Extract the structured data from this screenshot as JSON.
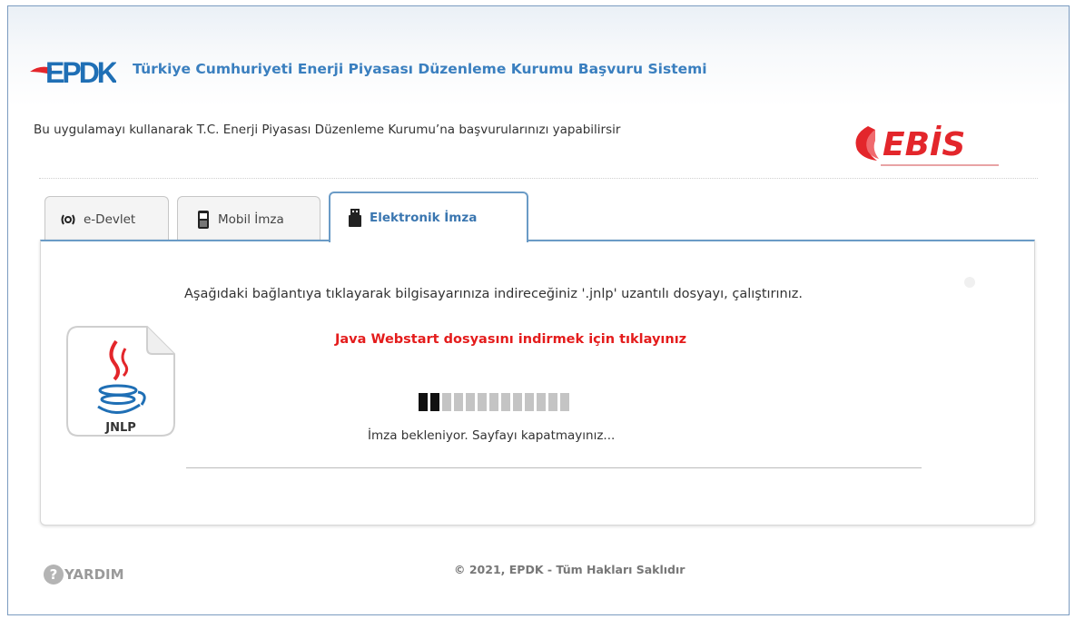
{
  "header": {
    "logo_text": "EPDK",
    "title": "Türkiye Cumhuriyeti Enerji Piyasası Düzenleme Kurumu Başvuru Sistemi",
    "intro": "Bu uygulamayı kullanarak T.C. Enerji Piyasası Düzenleme Kurumu’na başvurularınızı yapabilirsir",
    "ebis_logo_text": "EBİS"
  },
  "tabs": [
    {
      "label": "e-Devlet",
      "icon": "e-devlet-icon",
      "active": false
    },
    {
      "label": "Mobil İmza",
      "icon": "mobile-phone-icon",
      "active": false
    },
    {
      "label": "Elektronik İmza",
      "icon": "usb-token-icon",
      "active": true
    }
  ],
  "panel": {
    "instruction": "Aşağıdaki bağlantıya tıklayarak bilgisayarınıza indireceğiniz '.jnlp' uzantılı dosyayı, çalıştırınız.",
    "download_link": "Java Webstart dosyasını indirmek için tıklayınız",
    "file_icon_label": "JNLP",
    "progress": {
      "total_segments": 13,
      "filled_segments": 2
    },
    "status": "İmza bekleniyor. Sayfayı kapatmayınız..."
  },
  "footer": {
    "help_label": "YARDIM",
    "copyright": "© 2021, EPDK - Tüm Hakları Saklıdır"
  },
  "colors": {
    "accent_blue": "#3a7fbf",
    "link_red": "#e41c1c",
    "logo_red": "#e3262b"
  }
}
